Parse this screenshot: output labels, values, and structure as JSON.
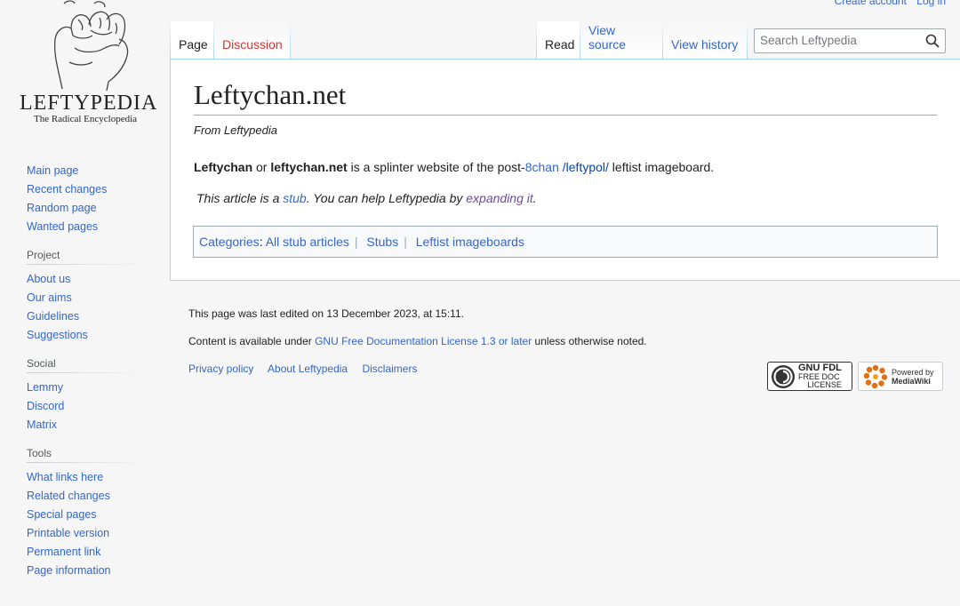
{
  "personal": {
    "create_account": "Create account",
    "login": "Log in"
  },
  "logo": {
    "title": "LEFTYPEDIA",
    "subtitle": "The Radical Encyclopedia"
  },
  "tabs": {
    "page": "Page",
    "discussion": "Discussion",
    "read": "Read",
    "view_source": "View source",
    "view_history": "View history"
  },
  "search": {
    "placeholder": "Search Leftypedia"
  },
  "sidebar": {
    "navigation": [
      "Main page",
      "Recent changes",
      "Random page",
      "Wanted pages"
    ],
    "project": {
      "heading": "Project",
      "items": [
        "About us",
        "Our aims",
        "Guidelines",
        "Suggestions"
      ]
    },
    "social": {
      "heading": "Social",
      "items": [
        "Lemmy",
        "Discord",
        "Matrix"
      ]
    },
    "tools": {
      "heading": "Tools",
      "items": [
        "What links here",
        "Related changes",
        "Special pages",
        "Printable version",
        "Permanent link",
        "Page information"
      ]
    }
  },
  "article": {
    "title": "Leftychan.net",
    "site_sub": "From Leftypedia",
    "para": {
      "b1": "Leftychan",
      "t1": " or ",
      "b2": "leftychan.net",
      "t2": " is a splinter website of the post-",
      "link1": "8chan",
      "t3": " ",
      "link2": "/leftypol/",
      "t4": " leftist imageboard."
    },
    "stub": {
      "t1": "This article is a ",
      "link1": "stub",
      "t2": ". You can help Leftypedia by ",
      "link2": "expanding it",
      "t3": "."
    },
    "categories": {
      "label": "Categories",
      "items": [
        "All stub articles",
        "Stubs",
        "Leftist imageboards"
      ]
    }
  },
  "footer": {
    "last_edited": "This page was last edited on 13 December 2023, at 15:11.",
    "license_pre": "Content is available under ",
    "license_link": "GNU Free Documentation License 1.3 or later",
    "license_post": " unless otherwise noted.",
    "places": [
      "Privacy policy",
      "About Leftypedia",
      "Disclaimers"
    ],
    "badge_gfdl": [
      "GNU FDL",
      "FREE DOC",
      "LICENSE"
    ],
    "badge_mw": [
      "Powered by",
      "MediaWiki"
    ]
  }
}
